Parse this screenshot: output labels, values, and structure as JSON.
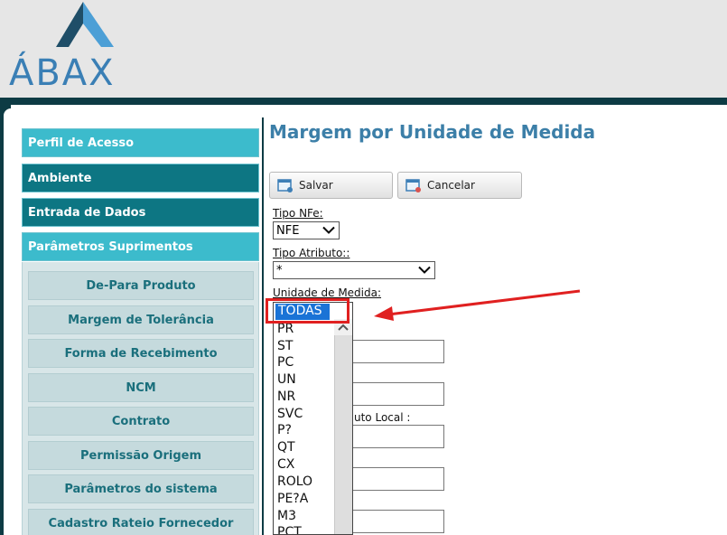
{
  "header": {
    "logo_text": "ÁBAX",
    "colors": {
      "logo_dark": "#1f4e68",
      "logo_light": "#4c9fd6",
      "band": "#0d3b44"
    }
  },
  "sidebar": {
    "sections": [
      {
        "label": "Perfil de Acesso",
        "style": "light"
      },
      {
        "label": "Ambiente",
        "style": "dark"
      },
      {
        "label": "Entrada de Dados",
        "style": "dark"
      },
      {
        "label": "Parâmetros Suprimentos",
        "style": "light"
      }
    ],
    "items": [
      {
        "label": "De-Para Produto"
      },
      {
        "label": "Margem de Tolerância"
      },
      {
        "label": "Forma de Recebimento"
      },
      {
        "label": "NCM"
      },
      {
        "label": "Contrato"
      },
      {
        "label": "Permissão Origem"
      },
      {
        "label": "Parâmetros do sistema"
      },
      {
        "label": "Cadastro Rateio Fornecedor"
      }
    ]
  },
  "main": {
    "title": "Margem por Unidade de Medida",
    "toolbar": {
      "save_label": "Salvar",
      "cancel_label": "Cancelar"
    },
    "fields": {
      "tipo_nfe": {
        "label": "Tipo NFe:",
        "value": "NFE"
      },
      "tipo_atributo": {
        "label": "Tipo Atributo::",
        "value": "*"
      },
      "unidade_medida": {
        "label": "Unidade de Medida:"
      },
      "produto_local_label_fragment": "uto Local :"
    },
    "dropdown": {
      "selected": "TODAS",
      "options": [
        "PR",
        "ST",
        "PC",
        "UN",
        "NR",
        "SVC",
        "P?",
        "QT",
        "CX",
        "ROLO",
        "PE?A",
        "M3",
        "PCT"
      ]
    }
  },
  "annotation": {
    "color": "#e02020"
  }
}
